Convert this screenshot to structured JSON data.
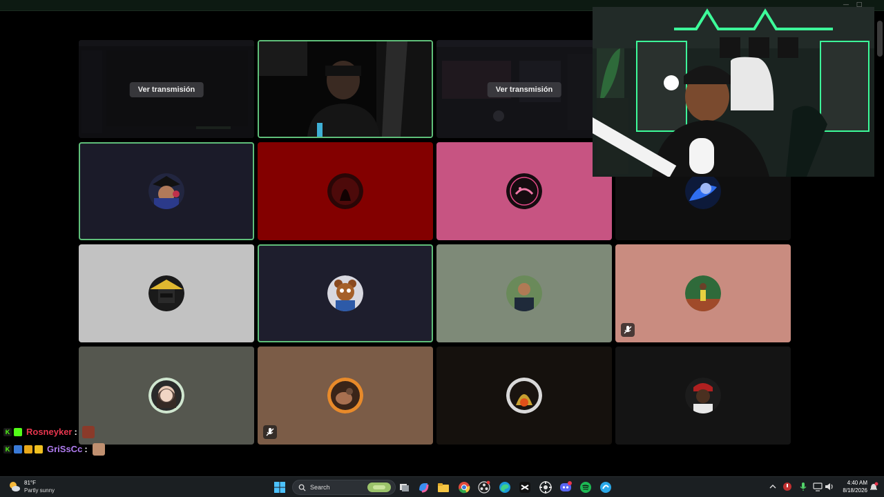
{
  "window": {
    "minimize_glyph": "—",
    "maximize_glyph": "□"
  },
  "tiles": [
    {
      "type": "screen",
      "button_label": "Ver transmisión"
    },
    {
      "type": "camera"
    },
    {
      "type": "screen",
      "button_label": "Ver transmisión"
    },
    {
      "type": "avatar",
      "bg": "#1b1b29",
      "speaking": true
    },
    {
      "type": "avatar",
      "bg": "#830000",
      "speaking": false
    },
    {
      "type": "avatar",
      "bg": "#c75482",
      "speaking": false
    },
    {
      "type": "avatar",
      "bg": "#0f0f0f",
      "speaking": false
    },
    {
      "type": "avatar",
      "bg": "#c2c2c2",
      "speaking": false
    },
    {
      "type": "avatar",
      "bg": "#1e1e2d",
      "speaking": true
    },
    {
      "type": "avatar",
      "bg": "#7e8a78",
      "speaking": false
    },
    {
      "type": "avatar",
      "bg": "#c98c80",
      "speaking": false,
      "muted_icon": true
    },
    {
      "type": "avatar",
      "bg": "#55574f",
      "speaking": false
    },
    {
      "type": "avatar",
      "bg": "#7b5c47",
      "speaking": false,
      "muted_icon": true
    },
    {
      "type": "avatar",
      "bg": "#15110d",
      "speaking": false
    },
    {
      "type": "avatar",
      "bg": "#141414",
      "speaking": false
    }
  ],
  "chat": [
    {
      "username": "Rosneyker",
      "color": "#e8364e",
      "colon": ":"
    },
    {
      "username": "GriSsCc",
      "color": "#b07cf0",
      "colon": ":"
    }
  ],
  "taskbar": {
    "weather_temp": "81°F",
    "weather_condition": "Partly sunny",
    "search_label": "Search",
    "time": "4:40 AM",
    "date": "8/18/2026",
    "icons": [
      "windows-start-icon",
      "search-icon",
      "task-view-icon",
      "copilot-icon",
      "file-explorer-icon",
      "chrome-icon",
      "obs-icon",
      "edge-icon",
      "capcut-icon",
      "steam-icon",
      "discord-icon",
      "spotify-icon",
      "app-icon"
    ]
  },
  "colors": {
    "speaking_border": "#5fbf7a",
    "taskbar_bg": "#1b1f22"
  }
}
